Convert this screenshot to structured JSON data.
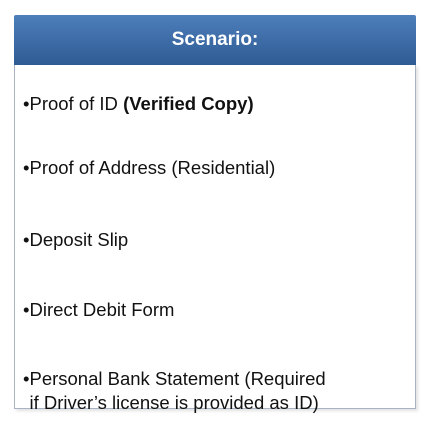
{
  "card": {
    "title": "Scenario:",
    "bullet_char": "•",
    "items": [
      {
        "text": "Proof of ID ",
        "emphasis": "(Verified Copy)"
      },
      {
        "text": "Proof of Address (Residential)"
      },
      {
        "text": "Deposit Slip"
      },
      {
        "text": "Direct Debit Form"
      },
      {
        "line1": "Personal Bank Statement (Required",
        "line2": "if Driver’s license is provided as ID)"
      }
    ]
  },
  "colors": {
    "header_gradient_top": "#4e7fbb",
    "header_gradient_bottom": "#2f5b93",
    "header_text": "#ffffff",
    "body_background": "#ffffff",
    "border": "#a8b3c3"
  }
}
